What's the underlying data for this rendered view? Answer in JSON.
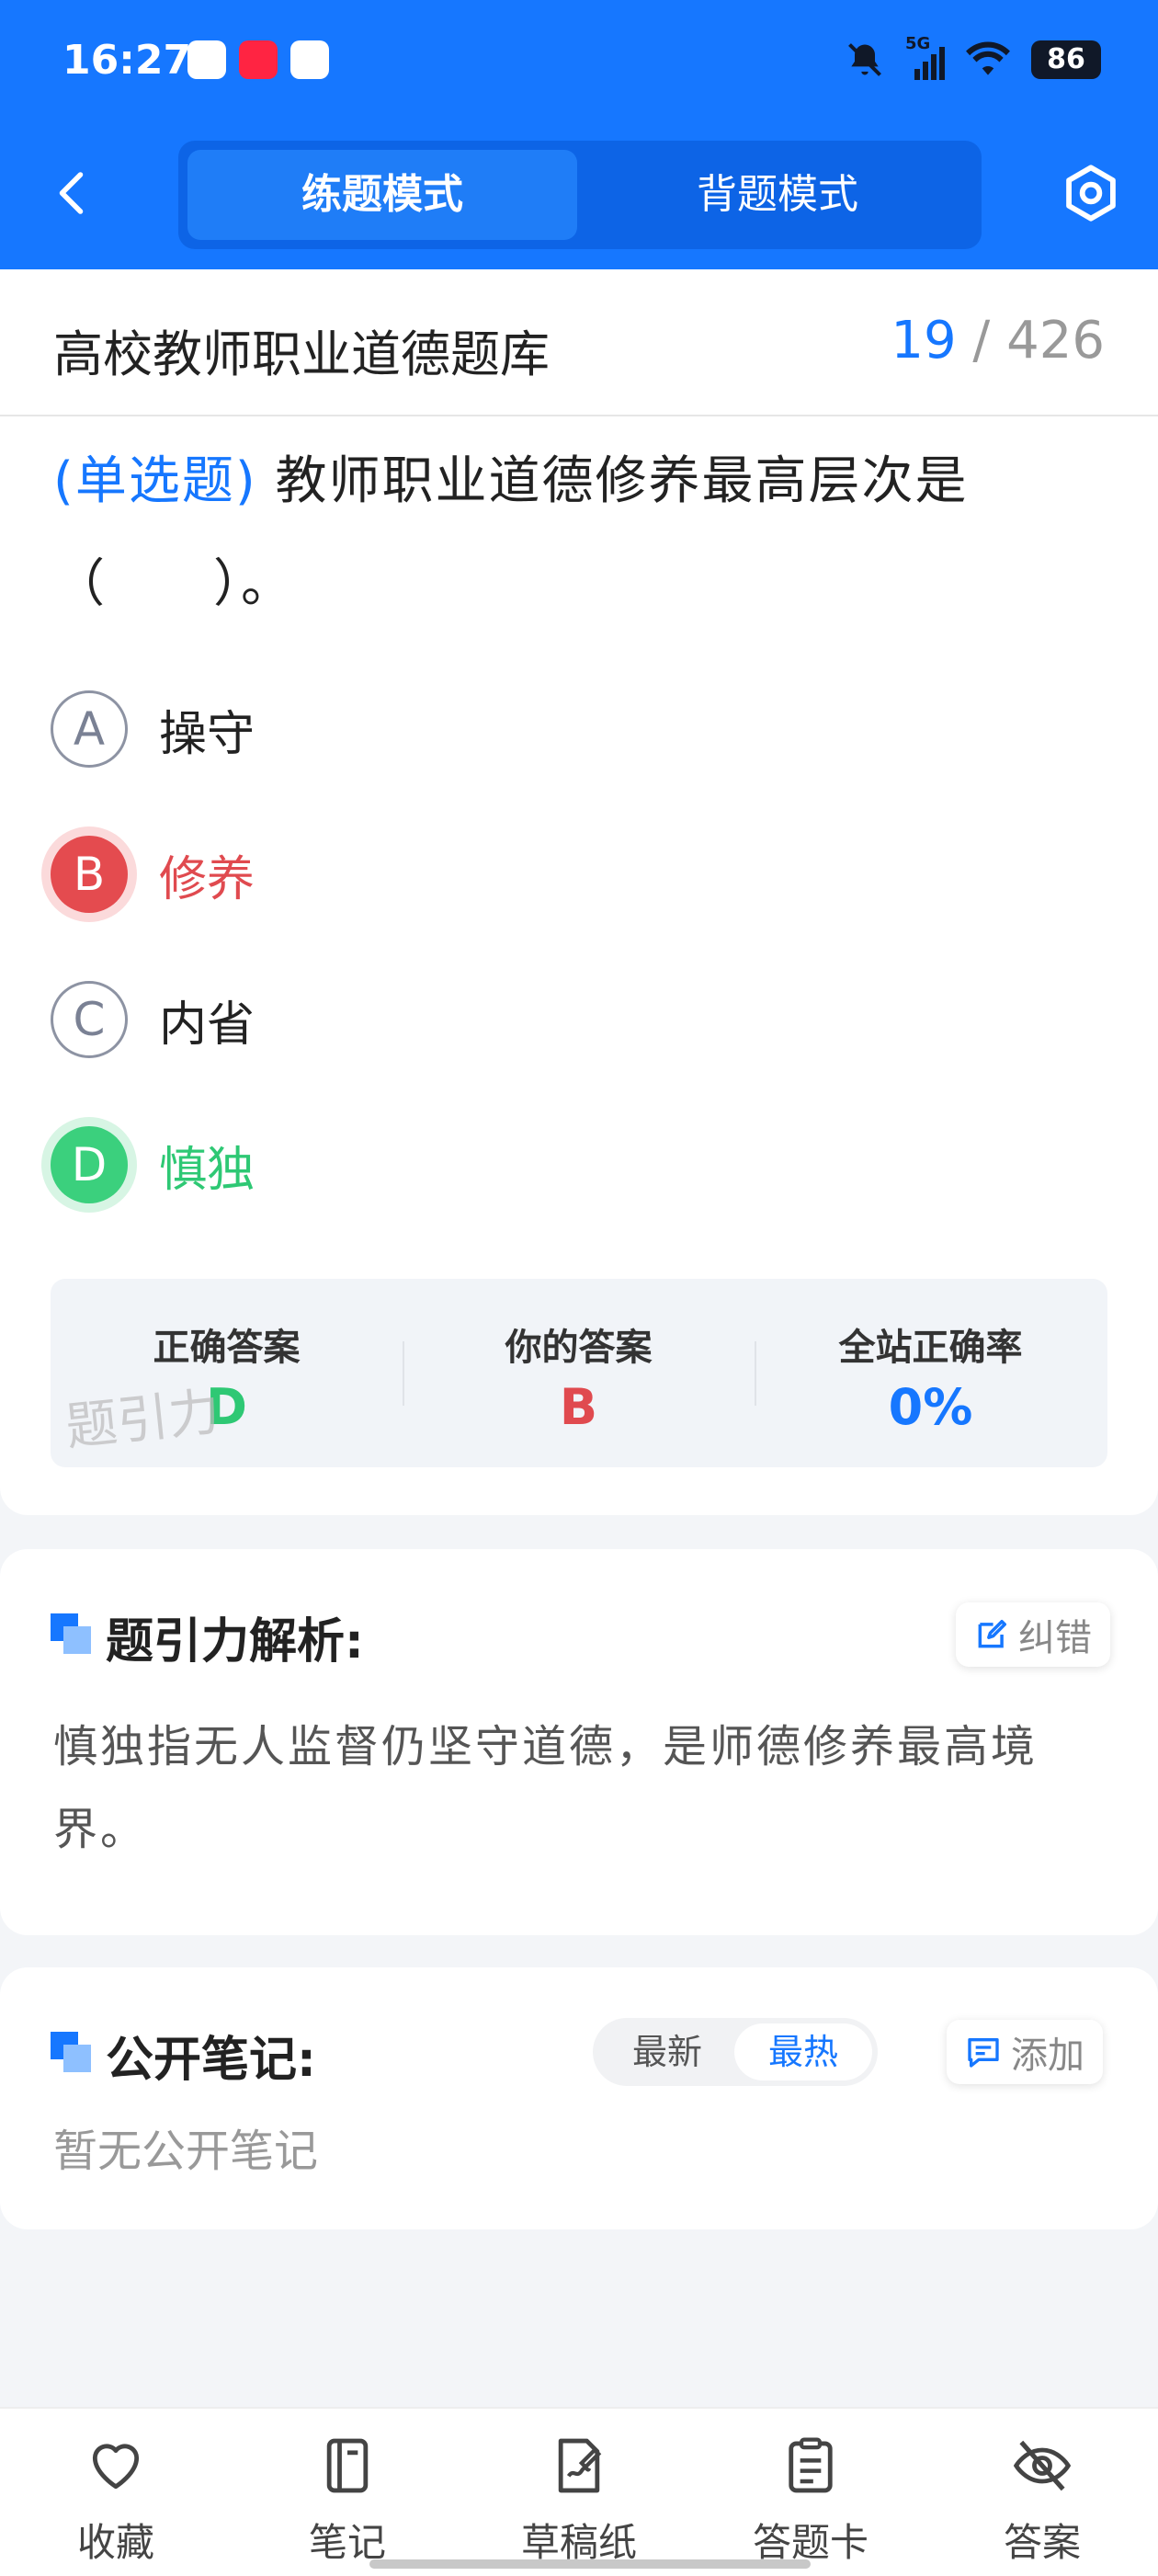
{
  "status_bar": {
    "time": "16:27",
    "network": "5G",
    "battery": "86"
  },
  "nav": {
    "mode_practice": "练题模式",
    "mode_recite": "背题模式"
  },
  "header": {
    "bank_title": "高校教师职业道德题库",
    "current": "19",
    "separator": "/",
    "total": "426"
  },
  "question": {
    "type": "(单选题)",
    "text": "教师职业道德修养最高层次是（　　）。"
  },
  "options": [
    {
      "letter": "A",
      "text": "操守",
      "state": "normal"
    },
    {
      "letter": "B",
      "text": "修养",
      "state": "wrong"
    },
    {
      "letter": "C",
      "text": "内省",
      "state": "normal"
    },
    {
      "letter": "D",
      "text": "慎独",
      "state": "correct"
    }
  ],
  "stats": {
    "correct_label": "正确答案",
    "correct_value": "D",
    "yours_label": "你的答案",
    "yours_value": "B",
    "rate_label": "全站正确率",
    "rate_value": "0%",
    "watermark": "题引力"
  },
  "analysis": {
    "title": "题引力解析:",
    "report_label": "纠错",
    "text": "慎独指无人监督仍坚守道德，是师德修养最高境界。"
  },
  "notes": {
    "title": "公开笔记:",
    "sort_new": "最新",
    "sort_hot": "最热",
    "add_label": "添加",
    "empty": "暂无公开笔记"
  },
  "bottom_tabs": [
    {
      "label": "收藏",
      "icon": "heart-icon"
    },
    {
      "label": "笔记",
      "icon": "notebook-icon"
    },
    {
      "label": "草稿纸",
      "icon": "draft-paper-icon"
    },
    {
      "label": "答题卡",
      "icon": "answer-card-icon"
    },
    {
      "label": "答案",
      "icon": "eye-off-icon"
    }
  ],
  "colors": {
    "primary": "#1677ff",
    "wrong": "#e44b4f",
    "correct": "#3bd07d"
  }
}
